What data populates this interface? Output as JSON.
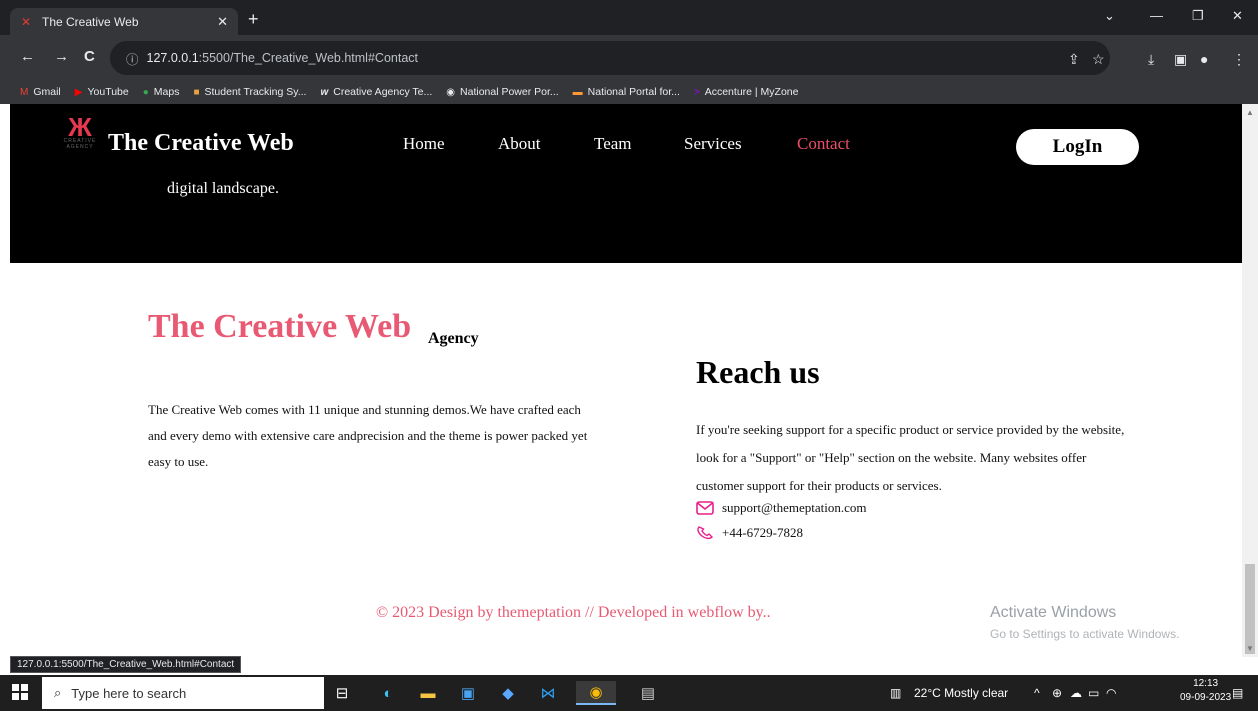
{
  "browser": {
    "tab_title": "The Creative Web",
    "url_host": "127.0.0.1",
    "url_rest": ":5500/The_Creative_Web.html#Contact",
    "status_url": "127.0.0.1:5500/The_Creative_Web.html#Contact",
    "bookmarks": [
      "Gmail",
      "YouTube",
      "Maps",
      "Student Tracking Sy...",
      "Creative Agency Te...",
      "National Power Por...",
      "National Portal for...",
      "Accenture | MyZone"
    ]
  },
  "site": {
    "logo_sub": "CREATIVE AGENCY",
    "brand": "The Creative Web",
    "nav": [
      "Home",
      "About",
      "Team",
      "Services",
      "Contact"
    ],
    "login": "LogIn",
    "tagline": "digital landscape."
  },
  "agency": {
    "title": "The Creative Web",
    "sub": "Agency",
    "desc": "The Creative Web comes with 11 unique and stunning demos.We have crafted each and every demo with extensive care andprecision and the theme is power packed yet easy to use."
  },
  "reach": {
    "title": "Reach us",
    "desc": "If you're seeking support for a specific product or service provided by the website, look for a \"Support\" or \"Help\" section on the website. Many websites offer customer support for their products or services.",
    "email": "support@themeptation.com",
    "phone": "+44-6729-7828"
  },
  "footer": "© 2023 Design by themeptation // Developed in webflow by..",
  "watermark": {
    "line1": "Activate Windows",
    "line2": "Go to Settings to activate Windows."
  },
  "taskbar": {
    "search_placeholder": "Type here to search",
    "weather": "22°C  Mostly clear",
    "time": "12:13",
    "date": "09-09-2023"
  },
  "colors": {
    "accent": "#e85a73",
    "header_bg": "#000000"
  }
}
